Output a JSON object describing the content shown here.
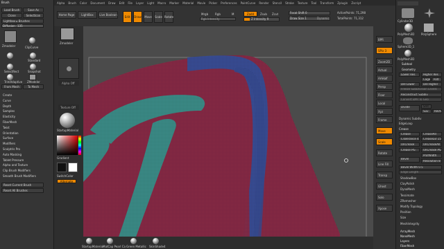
{
  "menu": [
    "Alpha",
    "Brush",
    "Color",
    "Document",
    "Draw",
    "Edit",
    "File",
    "Layer",
    "Light",
    "Macro",
    "Marker",
    "Material",
    "Movie",
    "Picker",
    "Preferences",
    "PaintCurve",
    "Render",
    "Stencil",
    "Stroke",
    "Texture",
    "Tool",
    "Transform",
    "Zplugin",
    "Zscript"
  ],
  "left_panel": {
    "title": "Brush",
    "load_label": "Load Brush",
    "save_label": "Save As",
    "clone_label": "Clone",
    "select_label": "SelectIcon",
    "lightbox_label": "Lightbox ▸ Brushes",
    "diffusion_label": "Diffusion",
    "diffusion_value": "135",
    "brushes": [
      "Zmodeler",
      "ClipCurve",
      "Standard",
      "SelectRect",
      "Snapshot",
      "TrimAdaptive",
      "ZModeler"
    ],
    "from_mesh": "From Mesh",
    "to_mesh": "To Mesh",
    "sections": [
      "Create",
      "Curve",
      "Depth",
      "Samples",
      "Elasticity",
      "FiberMesh",
      "Twist",
      "Orientation",
      "Surface",
      "Modifiers",
      "Sculptris Pro",
      "Auto Masking",
      "Tablet Pressure",
      "Alpha and Texture",
      "Clip Brush Modifiers",
      "Smooth Brush Modifiers"
    ],
    "reset_current": "Reset Current Brush",
    "reset_all": "Reset All Brushes"
  },
  "toolbar": {
    "home": "Home Page",
    "lightbox": "LightBox",
    "live_boolean": "Live Boolean",
    "edit": "Edit",
    "draw": "Draw",
    "move": "Move",
    "scale": "Scale",
    "rotate": "Rotate",
    "mrgb": "Mrgb",
    "rgb": "Rgb",
    "m": "M",
    "zadd": "Zadd",
    "zsub": "Zsub",
    "zcut": "Zcut",
    "rgb_intensity": "Rgb Intensity",
    "z_intensity": "Z Intensity 9",
    "focal_shift": "Focal Shift 0",
    "draw_size": "Draw Size 1",
    "dynamic": "Dynamic",
    "active_points": "ActivePoints: 71,298",
    "total_points": "TotalPoints: 71,312"
  },
  "shelf2": {
    "polysphere_a": "Zmodeler",
    "polysphere_b": "PolySphere",
    "alpha_off": "Alpha Off",
    "texture_off": "Texture Off",
    "material": "StartupMaterial",
    "gradient": "Gradient",
    "switch_color": "SwitchColor",
    "alternate": "Alternate"
  },
  "right_shelf": [
    "BPR",
    "SPix 3",
    "Zoom2D",
    "Actual",
    "AAHalf",
    "Persp",
    "Floor",
    "Local",
    "Xyz",
    "Frame",
    "Move",
    "Scale",
    "Rotate",
    "Line Fill",
    "Transp",
    "Ghost",
    "Solo",
    "Xpose"
  ],
  "right_tray": {
    "thumbs": [
      "Cylinder3D",
      "PolyMesh3D",
      "SimpleBrush",
      "PolySphere",
      "Sphere3D_1",
      "PolyMesh3D"
    ],
    "section_subtool": "Subtool",
    "section_geometry": "Geometry",
    "higher_res": "Higher Res",
    "lower_res": "Lower Res",
    "cage": "Cage",
    "rstr": "Rstr",
    "del_lower": "Del Lower",
    "del_higher": "Del Higher",
    "freeze": "Freeze SubDivision Levels",
    "reconstruct": "Reconstruct Subdiv",
    "convert_bpr": "Convert BPR To Geo",
    "divide": "Divide",
    "smt": "Smt",
    "suv": "Suv",
    "rsmt": "ReUV",
    "dynamic_subdiv": "Dynamic Subdiv",
    "edgeloop": "EdgeLoop",
    "crease": "Crease",
    "crease_title": "Crease",
    "crease_all": "CreaseAll",
    "crease_tolerance": "CTolerance 45",
    "crease_lvl": "CreaseLvl 15",
    "uncrease": "UnCrease",
    "uncrease_all": "UnCreaseAll",
    "crease_pg": "Crease PG",
    "uncrease_pg": "UnCrease PG",
    "bevel": "Bevel",
    "bevel_resolution": "Resolution 8",
    "bevel_prof": "ProfWidth",
    "bevel_width": "Bevel Width 0.5",
    "edge_length": "Edge Length",
    "sections": [
      "ShadowBox",
      "ClayPolish",
      "DynaMesh",
      "Tessimate",
      "ZRemesher",
      "Modify Topology",
      "Position",
      "Size",
      "MeshIntegrity"
    ],
    "bottom": [
      "ArrayMesh",
      "NanoMesh",
      "Layers",
      "FiberMesh"
    ]
  },
  "bottom_materials": [
    "StartupMaterial",
    "MatCap Pearl Ca",
    "Green Metallic",
    "SkinShade4"
  ],
  "colors": {
    "accent": "#f08a00",
    "mesh_red": "#8a2a46",
    "mesh_blue": "#3a4f98",
    "mesh_teal": "#3d8f8a"
  }
}
